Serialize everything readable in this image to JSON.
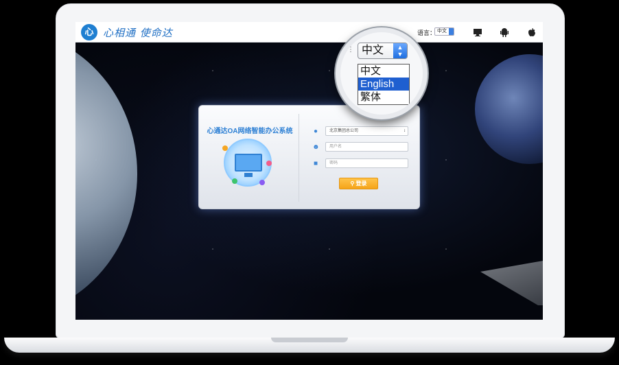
{
  "header": {
    "logo_glyph": "心",
    "slogan": "心相通 使命达",
    "language_label": "语言：",
    "language_value": "中文"
  },
  "top_icons": [
    "desktop-icon",
    "android-icon",
    "apple-icon"
  ],
  "login": {
    "title": "心通达OA网络智能办公系统",
    "company_select": "北京集团总公司",
    "username_placeholder": "用户名",
    "password_placeholder": "密码",
    "login_button": "登录"
  },
  "magnifier": {
    "selected": "中文",
    "options": [
      "中文",
      "English",
      "繁体"
    ],
    "highlighted_option": "English"
  },
  "colors": {
    "brand_blue": "#2c7fd4",
    "login_orange": "#f5a419",
    "highlight_blue": "#1f5fd0"
  }
}
